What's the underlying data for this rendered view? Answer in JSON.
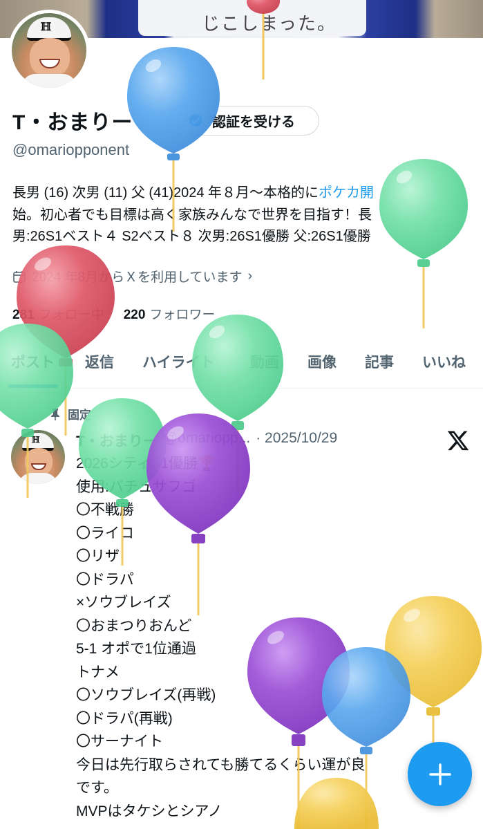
{
  "banner": {
    "text": "じこしまった。"
  },
  "profile": {
    "display_name": "T・おまりー",
    "verify_label": "認証を受ける",
    "handle": "@omariopponent",
    "bio_lines": [
      "長男 (16) 次男 (11) 父 (41)2024 年８月〜本格的に",
      "ポケカ開",
      "始。初心者でも目標は高く家族みんなで世界を目指す！長",
      "男:26S1ベスト４ S2ベスト８ 次男:26S1優勝 父:26S1優勝"
    ],
    "joined": "2024 年8月からＸを利用しています",
    "following_count": "281",
    "following_label": "フォロー中",
    "followers_count": "220",
    "followers_label": "フォロワー"
  },
  "tabs": [
    "ポスト",
    "返信",
    "ハイライト",
    "動画",
    "画像",
    "記事",
    "いいね"
  ],
  "pinned_tweet": {
    "pinned_label": "固定",
    "author_name": "T・おまりー",
    "author_handle": "@omariopp...",
    "date": "· 2025/10/29",
    "lines": [
      "2026シティS1優勝🏆",
      "使用:バチュサフゴ",
      "〇不戦勝",
      "〇ライコ",
      "〇リザ",
      "〇ドラパ",
      "×ソウブレイズ",
      "〇おまつりおんど",
      "5-1 オポで1位通過",
      "トナメ",
      "〇ソウブレイズ(再戦)",
      "〇ドラパ(再戦)",
      "〇サーナイト",
      "今日は先行取らされても勝てるくらい運が良",
      "です。",
      "MVPはタケシとシアノ"
    ]
  },
  "icons": {
    "verify": "verified-badge-icon",
    "calendar": "calendar-icon",
    "pin": "pin-icon",
    "x_logo": "x-logo-icon",
    "compose": "plus-icon"
  },
  "colors": {
    "accent": "#1d9bf0",
    "text": "#0f1419",
    "secondary": "#536471",
    "balloon_blue": "#5aa8ee",
    "balloon_green": "#74e0a9",
    "balloon_red": "#e05a6a",
    "balloon_purple": "#9b4fd6",
    "balloon_yellow": "#f5d05a"
  }
}
